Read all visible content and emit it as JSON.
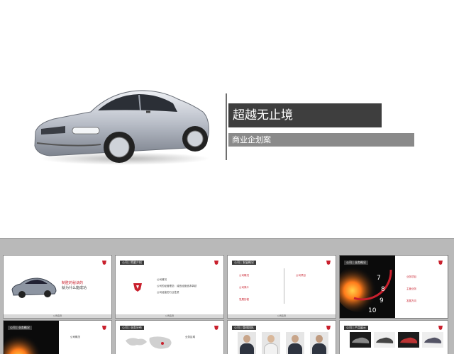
{
  "main_slide": {
    "title": "超越无止境",
    "subtitle": "商业企划案"
  },
  "thumbnails": [
    {
      "header": "",
      "lines": [
        "制胜的秘诀的",
        "就为什么能成功"
      ],
      "footer": "公司名称"
    },
    {
      "header": "公司 | 简要介绍",
      "bullets": [
        "公司情况",
        "公司的经营理念：诚信经营追求卓越",
        "公司经营的行业性质"
      ],
      "footer": "公司名称"
    },
    {
      "header": "公司 | 发展概况",
      "labels": [
        "公司概况",
        "公司简介",
        "发展历程",
        "公司项目"
      ],
      "footer": "公司名称"
    },
    {
      "header": "公司 | 业务概况",
      "labels": [
        "业务项目",
        "主营业务",
        "发展方向"
      ],
      "gauge_numbers": [
        "7",
        "8",
        "9",
        "10"
      ]
    },
    {
      "header": "公司 | 业务概况",
      "labels": [
        "公司概况"
      ]
    },
    {
      "header": "公司 | 业务分布",
      "labels": [
        "业务区域"
      ]
    },
    {
      "header": "公司 | 管理团队"
    },
    {
      "header": "公司 | 产品展示"
    }
  ],
  "colors": {
    "accent": "#c9202d",
    "dark": "#3e3e3e",
    "gray_bar": "#8a8a8a",
    "background": "#b9b9b9"
  }
}
